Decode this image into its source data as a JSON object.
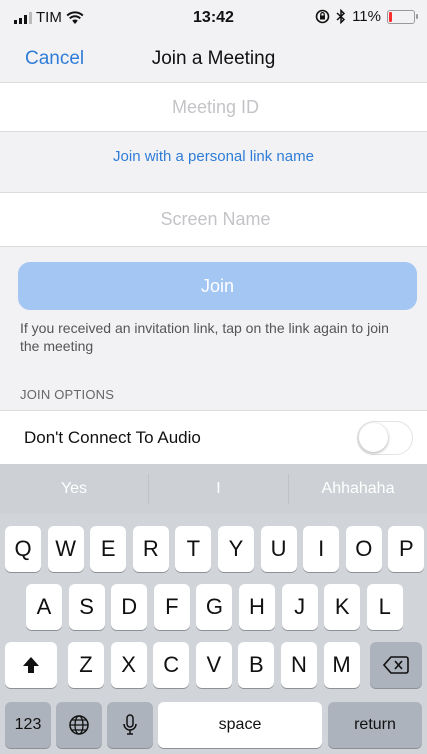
{
  "status_bar": {
    "carrier": "TIM",
    "time": "13:42",
    "battery": "11%",
    "battery_level": 0.11,
    "icons": [
      "signal-icon",
      "wifi-icon",
      "rotation-lock-icon",
      "bluetooth-icon",
      "battery-icon"
    ]
  },
  "nav": {
    "cancel_label": "Cancel",
    "title": "Join a Meeting"
  },
  "form": {
    "meeting_id_placeholder": "Meeting ID",
    "meeting_id_value": "",
    "personal_link_label": "Join with a personal link name",
    "screen_name_placeholder": "Screen Name",
    "screen_name_value": "",
    "join_label": "Join",
    "hint": "If you received an invitation link, tap on the link again to join the meeting"
  },
  "options": {
    "section_label": "JOIN OPTIONS",
    "dont_connect_audio_label": "Don't Connect To Audio",
    "dont_connect_audio_on": false
  },
  "keyboard": {
    "suggestions": [
      "Yes",
      "I",
      "Ahhahaha"
    ],
    "row1": [
      "Q",
      "W",
      "E",
      "R",
      "T",
      "Y",
      "U",
      "I",
      "O",
      "P"
    ],
    "row2": [
      "A",
      "S",
      "D",
      "F",
      "G",
      "H",
      "J",
      "K",
      "L"
    ],
    "row3": [
      "Z",
      "X",
      "C",
      "V",
      "B",
      "N",
      "M"
    ],
    "numbers_label": "123",
    "space_label": "space",
    "return_label": "return"
  },
  "colors": {
    "accent": "#2f7dd8",
    "join_button_disabled": "#a4c6f3",
    "battery_low": "#ff2d2d"
  }
}
